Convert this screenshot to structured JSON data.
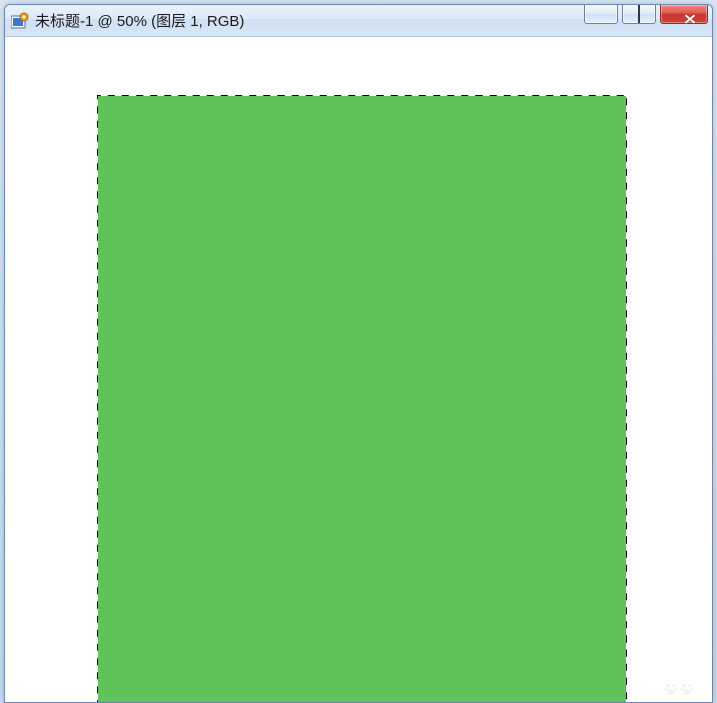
{
  "window": {
    "title": "未标题-1 @ 50% (图层 1, RGB)"
  },
  "buttons": {
    "minimize": "minimize",
    "maximize": "maximize",
    "close": "close"
  },
  "canvas": {
    "fill_color": "#62c25a"
  }
}
